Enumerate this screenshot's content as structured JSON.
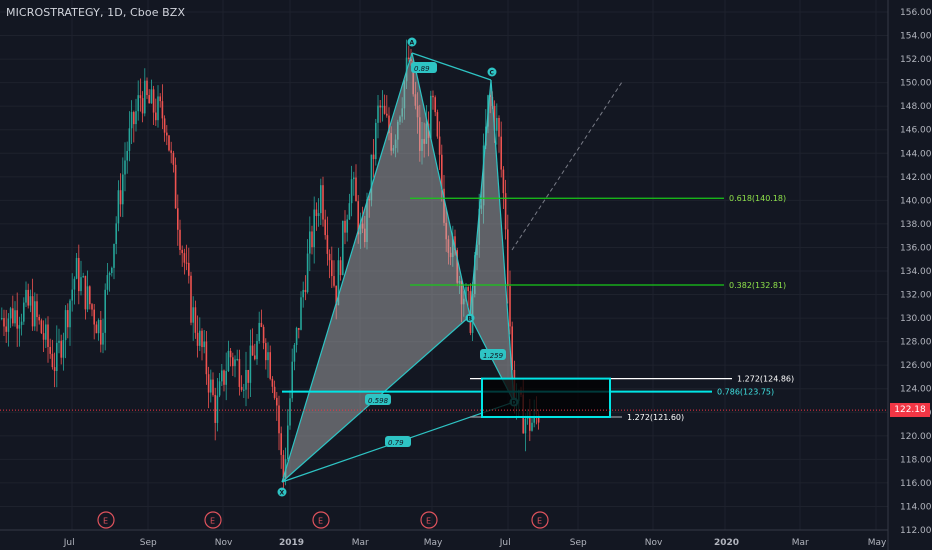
{
  "header": {
    "title": "MICROSTRATEGY, 1D, Cboe BZX"
  },
  "colors": {
    "background": "#131722",
    "grid": "#1e222d",
    "candle_up": "#26a69a",
    "candle_down": "#ef5350",
    "pattern_line": "#2ec4c4",
    "pattern_fill": "#bdbdbd",
    "fib_line": "#19c819",
    "fib_text": "#8fe34a",
    "box_border": "#00e5e5",
    "last_price": "#f23645",
    "white_line": "#ffffff"
  },
  "price_axis": {
    "ticks": [
      "156.00",
      "154.00",
      "152.00",
      "150.00",
      "148.00",
      "146.00",
      "144.00",
      "142.00",
      "140.00",
      "138.00",
      "136.00",
      "134.00",
      "132.00",
      "130.00",
      "128.00",
      "126.00",
      "124.00",
      "122.00",
      "120.00",
      "118.00",
      "116.00",
      "114.00",
      "112.00"
    ],
    "last_price": "122.18"
  },
  "time_axis": {
    "ticks": [
      "Jul",
      "Sep",
      "Nov",
      "2019",
      "Mar",
      "May",
      "Jul",
      "Sep",
      "Nov",
      "2020",
      "Mar",
      "May"
    ]
  },
  "events": {
    "label": "E",
    "count": 5
  },
  "pattern": {
    "points": [
      {
        "label": "X"
      },
      {
        "label": "A"
      },
      {
        "label": "B"
      },
      {
        "label": "C"
      },
      {
        "label": "D"
      }
    ],
    "ratios": [
      "0.89",
      "0.598",
      "0.79",
      "1.259"
    ]
  },
  "levels": [
    {
      "text": "0.618(140.18)",
      "value": 140.18
    },
    {
      "text": "0.382(132.81)",
      "value": 132.81
    },
    {
      "text": "1.272(124.86)",
      "value": 124.86
    },
    {
      "text": "0.786(123.75)",
      "value": 123.75
    },
    {
      "text": "1.272(121.60)",
      "value": 121.6
    }
  ]
}
